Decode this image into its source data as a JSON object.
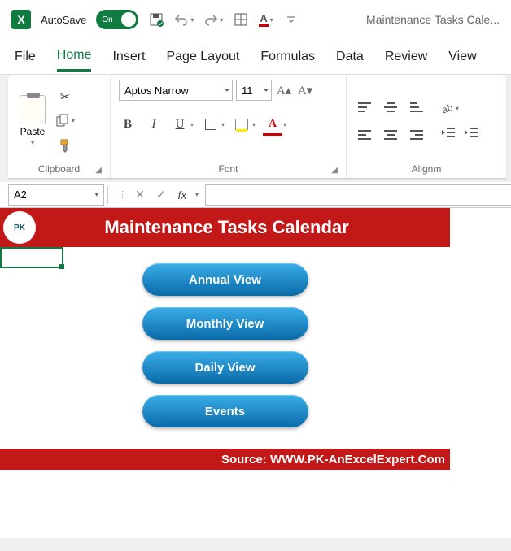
{
  "titlebar": {
    "autosave_label": "AutoSave",
    "toggle_state": "On",
    "doc_title": "Maintenance Tasks Cale..."
  },
  "tabs": {
    "file": "File",
    "home": "Home",
    "insert": "Insert",
    "page_layout": "Page Layout",
    "formulas": "Formulas",
    "data": "Data",
    "review": "Review",
    "view": "View"
  },
  "ribbon": {
    "clipboard": {
      "paste": "Paste",
      "label": "Clipboard"
    },
    "font": {
      "name": "Aptos Narrow",
      "size": "11",
      "label": "Font",
      "bold": "B",
      "italic": "I",
      "underline": "U",
      "fontcolor_glyph": "A"
    },
    "alignment": {
      "label": "Alignm"
    }
  },
  "formula_bar": {
    "cell_ref": "A2",
    "fx": "fx",
    "value": ""
  },
  "sheet": {
    "logo_text": "PK",
    "title": "Maintenance Tasks Calendar",
    "buttons": {
      "annual": "Annual View",
      "monthly": "Monthly View",
      "daily": "Daily View",
      "events": "Events"
    },
    "footer": "Source: WWW.PK-AnExcelExpert.Com"
  }
}
